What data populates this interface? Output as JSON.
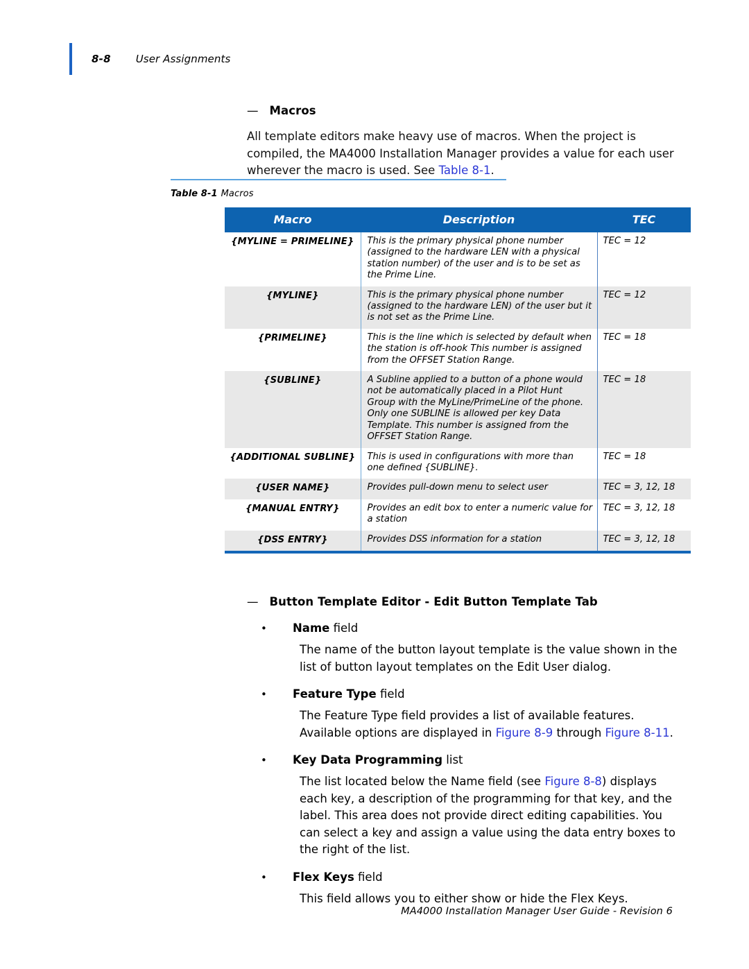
{
  "header": {
    "folio": "8-8",
    "title": "User Assignments"
  },
  "section": {
    "dash": "—",
    "heading": "Macros",
    "intro_paragraph_part1": "All template editors make heavy use of macros. When the project is compiled, the MA4000 Installation Manager provides a value for each user wherever the macro is used. See ",
    "intro_xref": "Table 8-1",
    "intro_paragraph_end": "."
  },
  "table": {
    "caption_label": "Table 8-1",
    "caption_text": "Macros",
    "columns": [
      "Macro",
      "Description",
      "TEC"
    ],
    "rows": [
      {
        "macro": "{MYLINE = PRIMELINE}",
        "description": "This is the primary physical phone number (assigned to the hardware LEN with a physical station number) of the user and is to be set as the Prime Line.",
        "tec": "TEC = 12",
        "shaded": false
      },
      {
        "macro": "{MYLINE}",
        "description": "This is the primary physical phone number (assigned to the hardware LEN) of the user but it is not set as the Prime Line.",
        "tec": "TEC = 12",
        "shaded": true
      },
      {
        "macro": "{PRIMELINE}",
        "description": "This is the line which is selected by default when the station is off-hook This number is assigned from the OFFSET Station Range.",
        "tec": "TEC = 18",
        "shaded": false
      },
      {
        "macro": "{SUBLINE}",
        "description": "A Subline applied to a button of a phone would not be automatically placed in a Pilot Hunt Group with the MyLine/PrimeLine of the phone. Only one SUBLINE is allowed per key Data Template. This number is assigned from the OFFSET Station Range.",
        "tec": "TEC = 18",
        "shaded": true
      },
      {
        "macro": "{ADDITIONAL SUBLINE}",
        "description": "This is used in configurations with more than one defined {SUBLINE}.",
        "tec": "TEC = 18",
        "shaded": false
      },
      {
        "macro": "{USER NAME}",
        "description": "Provides pull-down menu to select user",
        "tec": "TEC = 3, 12, 18",
        "shaded": true
      },
      {
        "macro": "{MANUAL ENTRY}",
        "description": "Provides an edit box to enter a numeric value for a station",
        "tec": "TEC = 3, 12, 18",
        "shaded": false
      },
      {
        "macro": "{DSS ENTRY}",
        "description": "Provides DSS information for a station",
        "tec": "TEC = 3, 12, 18",
        "shaded": true
      }
    ]
  },
  "section2": {
    "dash": "—",
    "heading": "Button Template Editor - Edit Button Template Tab",
    "bullets": [
      {
        "dot": "•",
        "label": "Name",
        "suffix": " field",
        "body_part1": "The name of the button layout template is the value shown in the list of button layout templates on the Edit User dialog.",
        "body_xrefs": []
      },
      {
        "dot": "•",
        "label": "Feature Type",
        "suffix": " field",
        "body_part1": "The Feature Type field provides a list of available features. Available options are displayed in ",
        "xref1": "Figure 8-9",
        "body_mid": " through ",
        "xref2": "Figure 8-11",
        "body_end": "."
      },
      {
        "dot": "•",
        "label": "Key Data Programming",
        "suffix": " list",
        "body_part1": "The list located below the Name field (see ",
        "xref1": "Figure 8-8",
        "body_end": ") displays each key, a description of the programming for that key, and the label. This area does not provide direct editing capabilities. You can select a key and assign a value using the data entry boxes to the right of the list."
      },
      {
        "dot": "•",
        "label": "Flex Keys",
        "suffix": " field",
        "body_part1": "This field allows you to either show or hide the Flex Keys."
      }
    ]
  },
  "footer": {
    "text": "MA4000 Installation Manager User Guide - Revision 6"
  }
}
